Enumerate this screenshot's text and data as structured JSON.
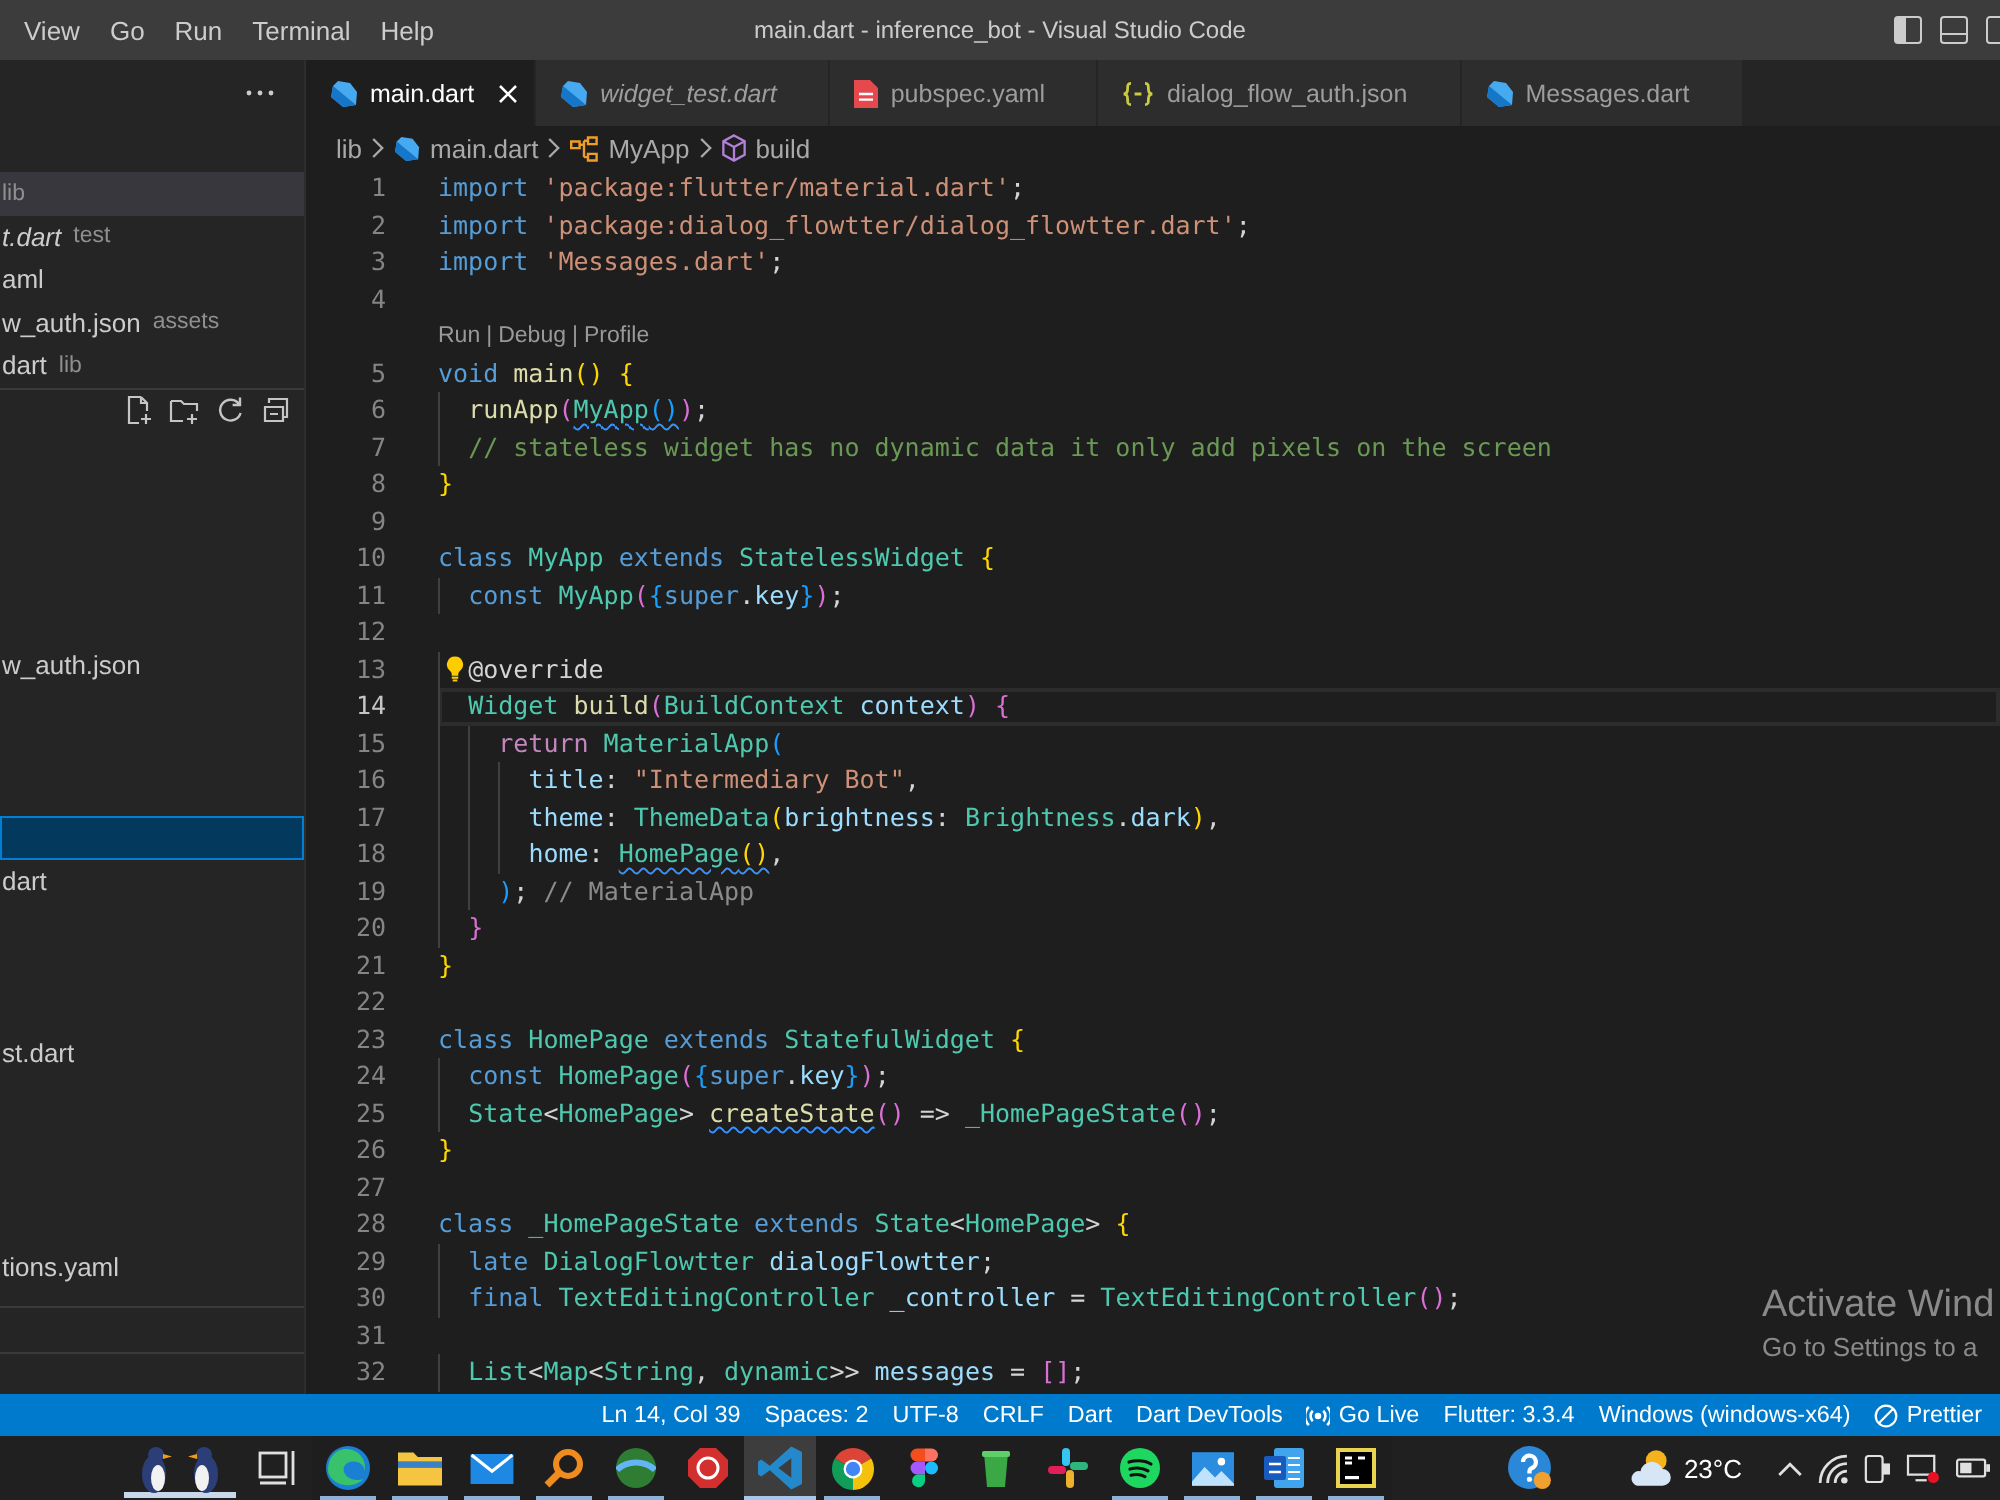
{
  "window": {
    "menu": [
      "View",
      "Go",
      "Run",
      "Terminal",
      "Help"
    ],
    "title": "main.dart - inference_bot - Visual Studio Code"
  },
  "sidebar": {
    "open_editors": [
      {
        "description": "lib",
        "selected": true
      },
      {
        "name": "t.dart",
        "description": "test",
        "selected": false,
        "preview": true
      },
      {
        "name": "aml",
        "selected": false,
        "preview": false
      },
      {
        "name": "w_auth.json",
        "description": "assets",
        "selected": false,
        "preview": false
      },
      {
        "name": "dart",
        "description": "lib",
        "selected": false,
        "preview": false
      }
    ],
    "explorer_tree": [
      {
        "selected": false
      },
      {
        "selected": false
      },
      {
        "selected": false
      },
      {
        "selected": false
      },
      {
        "selected": false
      },
      {
        "name": "w_auth.json",
        "selected": false
      },
      {
        "selected": false
      },
      {
        "selected": false
      },
      {
        "selected": false
      },
      {
        "selected": true
      },
      {
        "name": "dart",
        "selected": false
      },
      {
        "selected": false
      },
      {
        "selected": false
      },
      {
        "selected": false
      },
      {
        "name": "st.dart",
        "selected": false
      },
      {
        "selected": false
      },
      {
        "selected": false
      },
      {
        "selected": false
      },
      {
        "selected": false
      },
      {
        "name": "tions.yaml",
        "selected": false
      }
    ]
  },
  "tabs": [
    {
      "label": "main.dart",
      "kind": "dart",
      "selected": true,
      "preview": false
    },
    {
      "label": "widget_test.dart",
      "kind": "dart",
      "selected": false,
      "preview": true
    },
    {
      "label": "pubspec.yaml",
      "kind": "yaml",
      "selected": false,
      "preview": false
    },
    {
      "label": "dialog_flow_auth.json",
      "kind": "json",
      "selected": false,
      "preview": false
    },
    {
      "label": "Messages.dart",
      "kind": "dart",
      "selected": false,
      "preview": false
    }
  ],
  "breadcrumb": [
    {
      "label": "lib",
      "kind": "folder"
    },
    {
      "label": "main.dart",
      "kind": "dart"
    },
    {
      "label": "MyApp",
      "kind": "class"
    },
    {
      "label": "build",
      "kind": "method"
    }
  ],
  "editor": {
    "lines": [
      {
        "kind": "code",
        "number": "1",
        "current": false,
        "lightbulb": false,
        "tokens": [
          {
            "text": "import",
            "kind": "keyword",
            "squiggle": false
          },
          {
            "text": " 'package:flutter/material.dart'",
            "kind": "string",
            "squiggle": false
          },
          {
            "text": ";",
            "kind": "plain",
            "squiggle": false
          }
        ]
      },
      {
        "kind": "code",
        "number": "2",
        "current": false,
        "lightbulb": false,
        "tokens": [
          {
            "text": "import",
            "kind": "keyword",
            "squiggle": false
          },
          {
            "text": " 'package:dialog_flowtter/dialog_flowtter.dart'",
            "kind": "string",
            "squiggle": false
          },
          {
            "text": ";",
            "kind": "plain",
            "squiggle": false
          }
        ]
      },
      {
        "kind": "code",
        "number": "3",
        "current": false,
        "lightbulb": false,
        "tokens": [
          {
            "text": "import",
            "kind": "keyword",
            "squiggle": false
          },
          {
            "text": " 'Messages.dart'",
            "kind": "string",
            "squiggle": false
          },
          {
            "text": ";",
            "kind": "plain",
            "squiggle": false
          }
        ]
      },
      {
        "kind": "code",
        "number": "4",
        "current": false,
        "lightbulb": false
      },
      {
        "kind": "codelens",
        "links": [
          "Run",
          "Debug",
          "Profile"
        ],
        "separator": "|"
      },
      {
        "kind": "code",
        "number": "5",
        "current": false,
        "lightbulb": false,
        "tokens": [
          {
            "text": "void",
            "kind": "keyword",
            "squiggle": false
          },
          {
            "text": " main",
            "kind": "function",
            "squiggle": false
          },
          {
            "text": "() {",
            "kind": "bracket1",
            "squiggle": false
          }
        ]
      },
      {
        "kind": "code",
        "number": "6",
        "current": false,
        "lightbulb": false,
        "tokens": [
          {
            "text": "  runApp",
            "kind": "function",
            "squiggle": false
          },
          {
            "text": "(",
            "kind": "bracket2",
            "squiggle": false
          },
          {
            "text": "MyApp",
            "kind": "type",
            "squiggle": true
          },
          {
            "text": "()",
            "kind": "bracket3",
            "squiggle": true
          },
          {
            "text": ")",
            "kind": "bracket2",
            "squiggle": false
          },
          {
            "text": ";",
            "kind": "plain",
            "squiggle": false
          }
        ]
      },
      {
        "kind": "code",
        "number": "7",
        "current": false,
        "lightbulb": false,
        "tokens": [
          {
            "text": "  // stateless widget has no dynamic data it only add pixels on the screen",
            "kind": "comment",
            "squiggle": false
          }
        ]
      },
      {
        "kind": "code",
        "number": "8",
        "current": false,
        "lightbulb": false,
        "tokens": [
          {
            "text": "}",
            "kind": "bracket1",
            "squiggle": false
          }
        ]
      },
      {
        "kind": "code",
        "number": "9",
        "current": false,
        "lightbulb": false
      },
      {
        "kind": "code",
        "number": "10",
        "current": false,
        "lightbulb": false,
        "tokens": [
          {
            "text": "class",
            "kind": "keyword",
            "squiggle": false
          },
          {
            "text": " MyApp",
            "kind": "type",
            "squiggle": false
          },
          {
            "text": " extends",
            "kind": "keyword",
            "squiggle": false
          },
          {
            "text": " StatelessWidget",
            "kind": "type",
            "squiggle": false
          },
          {
            "text": " {",
            "kind": "bracket1",
            "squiggle": false
          }
        ]
      },
      {
        "kind": "code",
        "number": "11",
        "current": false,
        "lightbulb": false,
        "tokens": [
          {
            "text": "  const",
            "kind": "keyword",
            "squiggle": false
          },
          {
            "text": " MyApp",
            "kind": "type",
            "squiggle": false
          },
          {
            "text": "(",
            "kind": "bracket2",
            "squiggle": false
          },
          {
            "text": "{",
            "kind": "bracket3",
            "squiggle": false
          },
          {
            "text": "super",
            "kind": "keyword",
            "squiggle": false
          },
          {
            "text": ".",
            "kind": "plain",
            "squiggle": false
          },
          {
            "text": "key",
            "kind": "variable",
            "squiggle": false
          },
          {
            "text": "}",
            "kind": "bracket3",
            "squiggle": false
          },
          {
            "text": ")",
            "kind": "bracket2",
            "squiggle": false
          },
          {
            "text": ";",
            "kind": "plain",
            "squiggle": false
          }
        ]
      },
      {
        "kind": "code",
        "number": "12",
        "current": false,
        "lightbulb": false
      },
      {
        "kind": "code",
        "number": "13",
        "current": false,
        "lightbulb": true,
        "tokens": [
          {
            "text": "  @override",
            "kind": "plain",
            "squiggle": false
          }
        ]
      },
      {
        "kind": "code",
        "number": "14",
        "current": true,
        "lightbulb": false,
        "tokens": [
          {
            "text": "  Widget",
            "kind": "type",
            "squiggle": false
          },
          {
            "text": " build",
            "kind": "function",
            "squiggle": false
          },
          {
            "text": "(",
            "kind": "bracket2",
            "squiggle": false
          },
          {
            "text": "BuildContext",
            "kind": "type",
            "squiggle": false
          },
          {
            "text": " context",
            "kind": "variable",
            "squiggle": false
          },
          {
            "text": ") {",
            "kind": "bracket2",
            "squiggle": false
          }
        ]
      },
      {
        "kind": "code",
        "number": "15",
        "current": false,
        "lightbulb": false,
        "tokens": [
          {
            "text": "    return",
            "kind": "control",
            "squiggle": false
          },
          {
            "text": " MaterialApp",
            "kind": "type",
            "squiggle": false
          },
          {
            "text": "(",
            "kind": "bracket3",
            "squiggle": false
          }
        ]
      },
      {
        "kind": "code",
        "number": "16",
        "current": false,
        "lightbulb": false,
        "tokens": [
          {
            "text": "      title",
            "kind": "variable",
            "squiggle": false
          },
          {
            "text": ": ",
            "kind": "plain",
            "squiggle": false
          },
          {
            "text": "\"Intermediary Bot\"",
            "kind": "string",
            "squiggle": false
          },
          {
            "text": ",",
            "kind": "plain",
            "squiggle": false
          }
        ]
      },
      {
        "kind": "code",
        "number": "17",
        "current": false,
        "lightbulb": false,
        "tokens": [
          {
            "text": "      theme",
            "kind": "variable",
            "squiggle": false
          },
          {
            "text": ": ",
            "kind": "plain",
            "squiggle": false
          },
          {
            "text": "ThemeData",
            "kind": "type",
            "squiggle": false
          },
          {
            "text": "(",
            "kind": "bracket1",
            "squiggle": false
          },
          {
            "text": "brightness",
            "kind": "variable",
            "squiggle": false
          },
          {
            "text": ": ",
            "kind": "plain",
            "squiggle": false
          },
          {
            "text": "Brightness",
            "kind": "type",
            "squiggle": false
          },
          {
            "text": ".",
            "kind": "plain",
            "squiggle": false
          },
          {
            "text": "dark",
            "kind": "variable",
            "squiggle": false
          },
          {
            "text": ")",
            "kind": "bracket1",
            "squiggle": false
          },
          {
            "text": ",",
            "kind": "plain",
            "squiggle": false
          }
        ]
      },
      {
        "kind": "code",
        "number": "18",
        "current": false,
        "lightbulb": false,
        "tokens": [
          {
            "text": "      home",
            "kind": "variable",
            "squiggle": false
          },
          {
            "text": ": ",
            "kind": "plain",
            "squiggle": false
          },
          {
            "text": "HomePage",
            "kind": "type",
            "squiggle": true
          },
          {
            "text": "()",
            "kind": "bracket1",
            "squiggle": true
          },
          {
            "text": ",",
            "kind": "plain",
            "squiggle": false
          }
        ]
      },
      {
        "kind": "code",
        "number": "19",
        "current": false,
        "lightbulb": false,
        "tokens": [
          {
            "text": "    )",
            "kind": "bracket3",
            "squiggle": false
          },
          {
            "text": ";",
            "kind": "plain",
            "squiggle": false
          },
          {
            "text": " // MaterialApp",
            "kind": "hint",
            "squiggle": false
          }
        ]
      },
      {
        "kind": "code",
        "number": "20",
        "current": false,
        "lightbulb": false,
        "tokens": [
          {
            "text": "  }",
            "kind": "bracket2",
            "squiggle": false
          }
        ]
      },
      {
        "kind": "code",
        "number": "21",
        "current": false,
        "lightbulb": false,
        "tokens": [
          {
            "text": "}",
            "kind": "bracket1",
            "squiggle": false
          }
        ]
      },
      {
        "kind": "code",
        "number": "22",
        "current": false,
        "lightbulb": false
      },
      {
        "kind": "code",
        "number": "23",
        "current": false,
        "lightbulb": false,
        "tokens": [
          {
            "text": "class",
            "kind": "keyword",
            "squiggle": false
          },
          {
            "text": " HomePage",
            "kind": "type",
            "squiggle": false
          },
          {
            "text": " extends",
            "kind": "keyword",
            "squiggle": false
          },
          {
            "text": " StatefulWidget",
            "kind": "type",
            "squiggle": false
          },
          {
            "text": " {",
            "kind": "bracket1",
            "squiggle": false
          }
        ]
      },
      {
        "kind": "code",
        "number": "24",
        "current": false,
        "lightbulb": false,
        "tokens": [
          {
            "text": "  const",
            "kind": "keyword",
            "squiggle": false
          },
          {
            "text": " HomePage",
            "kind": "type",
            "squiggle": false
          },
          {
            "text": "(",
            "kind": "bracket2",
            "squiggle": false
          },
          {
            "text": "{",
            "kind": "bracket3",
            "squiggle": false
          },
          {
            "text": "super",
            "kind": "keyword",
            "squiggle": false
          },
          {
            "text": ".",
            "kind": "plain",
            "squiggle": false
          },
          {
            "text": "key",
            "kind": "variable",
            "squiggle": false
          },
          {
            "text": "}",
            "kind": "bracket3",
            "squiggle": false
          },
          {
            "text": ")",
            "kind": "bracket2",
            "squiggle": false
          },
          {
            "text": ";",
            "kind": "plain",
            "squiggle": false
          }
        ]
      },
      {
        "kind": "code",
        "number": "25",
        "current": false,
        "lightbulb": false,
        "tokens": [
          {
            "text": "  State",
            "kind": "type",
            "squiggle": false
          },
          {
            "text": "<",
            "kind": "plain",
            "squiggle": false
          },
          {
            "text": "HomePage",
            "kind": "type",
            "squiggle": false
          },
          {
            "text": "> ",
            "kind": "plain",
            "squiggle": false
          },
          {
            "text": "createState",
            "kind": "function",
            "squiggle": true
          },
          {
            "text": "()",
            "kind": "bracket2",
            "squiggle": false
          },
          {
            "text": " => ",
            "kind": "plain",
            "squiggle": false
          },
          {
            "text": "_HomePageState",
            "kind": "type",
            "squiggle": false
          },
          {
            "text": "()",
            "kind": "bracket2",
            "squiggle": false
          },
          {
            "text": ";",
            "kind": "plain",
            "squiggle": false
          }
        ]
      },
      {
        "kind": "code",
        "number": "26",
        "current": false,
        "lightbulb": false,
        "tokens": [
          {
            "text": "}",
            "kind": "bracket1",
            "squiggle": false
          }
        ]
      },
      {
        "kind": "code",
        "number": "27",
        "current": false,
        "lightbulb": false
      },
      {
        "kind": "code",
        "number": "28",
        "current": false,
        "lightbulb": false,
        "tokens": [
          {
            "text": "class",
            "kind": "keyword",
            "squiggle": false
          },
          {
            "text": " _HomePageState",
            "kind": "type",
            "squiggle": false
          },
          {
            "text": " extends",
            "kind": "keyword",
            "squiggle": false
          },
          {
            "text": " State",
            "kind": "type",
            "squiggle": false
          },
          {
            "text": "<",
            "kind": "plain",
            "squiggle": false
          },
          {
            "text": "HomePage",
            "kind": "type",
            "squiggle": false
          },
          {
            "text": "> ",
            "kind": "plain",
            "squiggle": false
          },
          {
            "text": "{",
            "kind": "bracket1",
            "squiggle": false
          }
        ]
      },
      {
        "kind": "code",
        "number": "29",
        "current": false,
        "lightbulb": false,
        "tokens": [
          {
            "text": "  late",
            "kind": "keyword",
            "squiggle": false
          },
          {
            "text": " DialogFlowtter",
            "kind": "type",
            "squiggle": false
          },
          {
            "text": " dialogFlowtter",
            "kind": "variable",
            "squiggle": false
          },
          {
            "text": ";",
            "kind": "plain",
            "squiggle": false
          }
        ]
      },
      {
        "kind": "code",
        "number": "30",
        "current": false,
        "lightbulb": false,
        "tokens": [
          {
            "text": "  final",
            "kind": "keyword",
            "squiggle": false
          },
          {
            "text": " TextEditingController",
            "kind": "type",
            "squiggle": false
          },
          {
            "text": " _controller",
            "kind": "variable",
            "squiggle": false
          },
          {
            "text": " = ",
            "kind": "plain",
            "squiggle": false
          },
          {
            "text": "TextEditingController",
            "kind": "type",
            "squiggle": false
          },
          {
            "text": "()",
            "kind": "bracket2",
            "squiggle": false
          },
          {
            "text": ";",
            "kind": "plain",
            "squiggle": false
          }
        ]
      },
      {
        "kind": "code",
        "number": "31",
        "current": false,
        "lightbulb": false
      },
      {
        "kind": "code",
        "number": "32",
        "current": false,
        "lightbulb": false,
        "tokens": [
          {
            "text": "  List",
            "kind": "type",
            "squiggle": false
          },
          {
            "text": "<",
            "kind": "plain",
            "squiggle": false
          },
          {
            "text": "Map",
            "kind": "type",
            "squiggle": false
          },
          {
            "text": "<",
            "kind": "plain",
            "squiggle": false
          },
          {
            "text": "String",
            "kind": "type",
            "squiggle": false
          },
          {
            "text": ", ",
            "kind": "plain",
            "squiggle": false
          },
          {
            "text": "dynamic",
            "kind": "type",
            "squiggle": false
          },
          {
            "text": ">> ",
            "kind": "plain",
            "squiggle": false
          },
          {
            "text": "messages",
            "kind": "variable",
            "squiggle": false
          },
          {
            "text": " = ",
            "kind": "plain",
            "squiggle": false
          },
          {
            "text": "[]",
            "kind": "bracket2",
            "squiggle": false
          },
          {
            "text": ";",
            "kind": "plain",
            "squiggle": false
          }
        ]
      }
    ]
  },
  "activation_notice": {
    "title": "Activate Wind",
    "subtitle": "Go to Settings to a"
  },
  "status_bar": {
    "items": [
      {
        "label": "Ln 14, Col 39",
        "kind": "plain"
      },
      {
        "label": "Spaces: 2",
        "kind": "plain"
      },
      {
        "label": "UTF-8",
        "kind": "plain"
      },
      {
        "label": "CRLF",
        "kind": "plain"
      },
      {
        "label": "Dart",
        "kind": "plain"
      },
      {
        "label": "Dart DevTools",
        "kind": "plain"
      },
      {
        "label": "Go Live",
        "kind": "broadcast"
      },
      {
        "label": "Flutter: 3.3.4",
        "kind": "plain"
      },
      {
        "label": "Windows (windows-x64)",
        "kind": "plain"
      },
      {
        "label": "Prettier",
        "kind": "blocked"
      }
    ]
  },
  "taskbar": {
    "apps": [
      {
        "running": true,
        "selected": false
      },
      {
        "running": true,
        "selected": false
      },
      {
        "running": true,
        "selected": false
      },
      {
        "running": true,
        "selected": false
      },
      {
        "running": true,
        "selected": false
      },
      {
        "running": false,
        "selected": false
      },
      {
        "running": true,
        "selected": true
      },
      {
        "running": true,
        "selected": false
      },
      {
        "running": false,
        "selected": false
      },
      {
        "running": false,
        "selected": false
      },
      {
        "running": false,
        "selected": false
      },
      {
        "running": true,
        "selected": false
      },
      {
        "running": true,
        "selected": false
      },
      {
        "running": true,
        "selected": false
      },
      {
        "running": true,
        "selected": false
      }
    ],
    "temperature": "23°C"
  }
}
